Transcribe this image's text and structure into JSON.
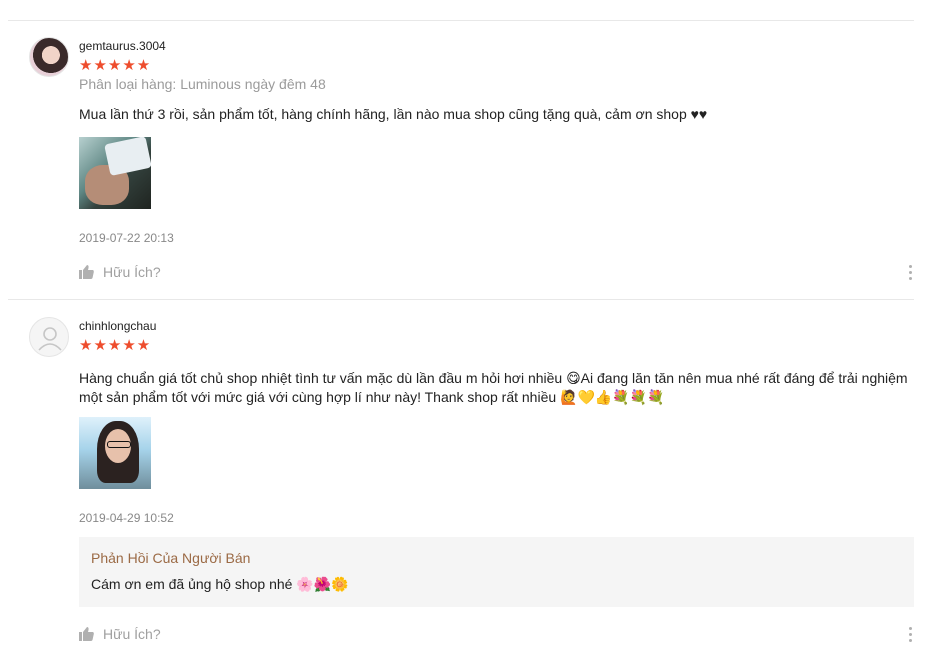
{
  "reviews": [
    {
      "username": "gemtaurus.3004",
      "stars": "★★★★★",
      "variation": "Phân loại hàng: Luminous ngày đêm 48",
      "comment": "Mua lần thứ 3 rồi, sản phẩm tốt, hàng chính hãng, lần nào mua shop cũng tặng quà, cảm ơn shop ♥♥",
      "datetime": "2019-07-22 20:13",
      "helpful_label": "Hữu Ích?",
      "avatar_icon": "user-photo-avatar",
      "image_icon": "product-photo"
    },
    {
      "username": "chinhlongchau",
      "stars": "★★★★★",
      "comment": "Hàng chuẩn giá tốt chủ shop nhiệt tình tư vấn mặc dù lần đầu m hỏi hơi nhiều 😋Ai đang lăn tăn nên mua nhé rất đáng để trải nghiệm một sản phẩm tốt với mức giá với cùng hợp lí như này! Thank shop rất nhiều 🙋💛👍💐💐💐",
      "datetime": "2019-04-29 10:52",
      "seller_reply": {
        "title": "Phản Hồi Của Người Bán",
        "text": "Cám ơn em đã ủng hộ shop nhé 🌸🌺🌼"
      },
      "helpful_label": "Hữu Ích?",
      "avatar_icon": "default-user-avatar",
      "image_icon": "selfie-photo"
    }
  ],
  "colors": {
    "star": "#ee4d2d",
    "seller_title": "#9b6a45",
    "muted": "#a0a0a0"
  }
}
